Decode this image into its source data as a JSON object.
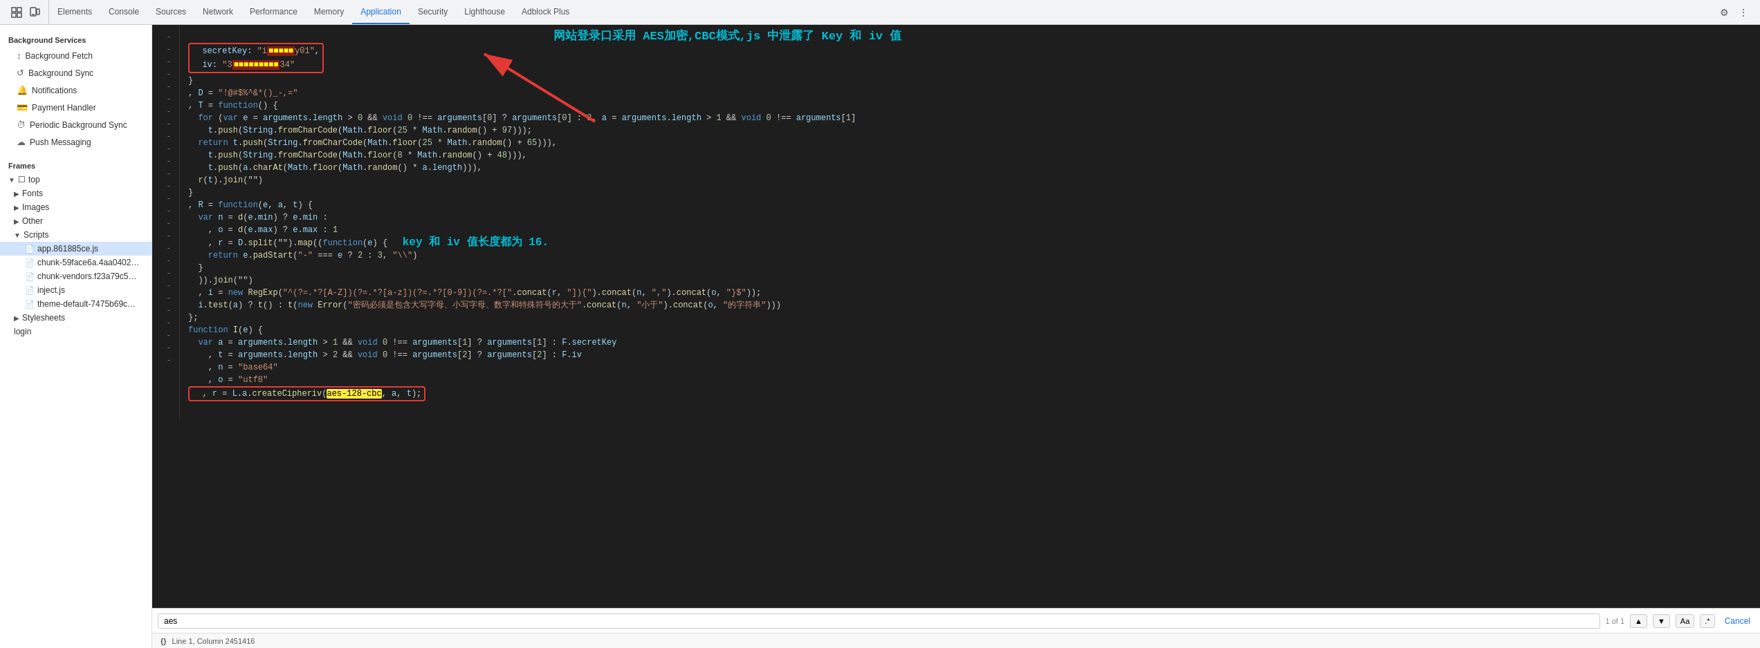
{
  "topNav": {
    "tabs": [
      {
        "label": "Elements",
        "active": false
      },
      {
        "label": "Console",
        "active": false
      },
      {
        "label": "Sources",
        "active": false
      },
      {
        "label": "Network",
        "active": false
      },
      {
        "label": "Performance",
        "active": false
      },
      {
        "label": "Memory",
        "active": false
      },
      {
        "label": "Application",
        "active": true
      },
      {
        "label": "Security",
        "active": false
      },
      {
        "label": "Lighthouse",
        "active": false
      },
      {
        "label": "Adblock Plus",
        "active": false
      }
    ]
  },
  "sidebar": {
    "backgroundServicesTitle": "Background Services",
    "backgroundServices": [
      {
        "label": "Background Fetch",
        "icon": "↕"
      },
      {
        "label": "Background Sync",
        "icon": "↺"
      },
      {
        "label": "Notifications",
        "icon": "🔔"
      },
      {
        "label": "Payment Handler",
        "icon": "💳"
      },
      {
        "label": "Periodic Background Sync",
        "icon": "⏱"
      },
      {
        "label": "Push Messaging",
        "icon": "☁"
      }
    ],
    "framesTitle": "Frames",
    "frames": [
      {
        "label": "top",
        "children": [
          {
            "label": "Fonts"
          },
          {
            "label": "Images"
          },
          {
            "label": "Other"
          },
          {
            "label": "Scripts",
            "expanded": true,
            "children": [
              {
                "label": "app.861885ce.js",
                "selected": true
              },
              {
                "label": "chunk-59face6a.4aa0402…"
              },
              {
                "label": "chunk-vendors.f23a79c5…"
              },
              {
                "label": "inject.js"
              },
              {
                "label": "theme-default-7475b69c…"
              }
            ]
          },
          {
            "label": "Stylesheets"
          },
          {
            "label": "login"
          }
        ]
      }
    ]
  },
  "code": {
    "lines": [
      {
        "num": "-",
        "content": "  secretKey: \"i■■■■■■■y01\","
      },
      {
        "num": "-",
        "content": "  iv: \"3■■■■■■■■■34\""
      },
      {
        "num": "-",
        "content": "}"
      },
      {
        "num": "-",
        "content": ", D = \"!@#$%^&*()_-,=\""
      },
      {
        "num": "-",
        "content": ", T = function() {"
      },
      {
        "num": "-",
        "content": "  for (var e = arguments.length > 0 && void 0 !== arguments[0] ? arguments[0] : 8, a = arguments.length > 1 && void 0 !== arguments[1]"
      },
      {
        "num": "-",
        "content": "    t.push(String.fromCharCode(Math.floor(25 * Math.random() + 97)));"
      },
      {
        "num": "-",
        "content": "  return t.push(String.fromCharCode(Math.floor(25 * Math.random() + 65))),"
      },
      {
        "num": "-",
        "content": "    t.push(String.fromCharCode(Math.floor(8 * Math.random() + 48))),"
      },
      {
        "num": "-",
        "content": "    t.push(a.charAt(Math.floor(Math.random() * a.length))),"
      },
      {
        "num": "-",
        "content": "  r(t).join(\"\")"
      },
      {
        "num": "-",
        "content": "}"
      },
      {
        "num": "-",
        "content": ", R = function(e, a, t) {"
      },
      {
        "num": "-",
        "content": "  var n = d(e.min) ? e.min :"
      },
      {
        "num": "-",
        "content": "    , o = d(e.max) ? e.max : 1"
      },
      {
        "num": "-",
        "content": "    , r = D.split(\"\").map((function(e) {"
      },
      {
        "num": "-",
        "content": "    return e.padStart(\"-\" === e ? 2 : 3, \"\\\\\")"
      },
      {
        "num": "-",
        "content": "  }"
      },
      {
        "num": "-",
        "content": "  )).join(\"\")"
      },
      {
        "num": "-",
        "content": "  , i = new RegExp(\"^(?=.*?[A-Z])(?=.*?[a-z])(?=.*?[0-9])(?=.*?[\\\".concat(r, \"]).{\").concat(n, \",\").concat(o, \"}$\"));"
      },
      {
        "num": "-",
        "content": "  i.test(a) ? t() : t(new Error(\"密码必须是包含大写字母、小写字母、数字和特殊符号的大于\".concat(n, \"小于\").concat(o, \"的字符串\")))"
      },
      {
        "num": "-",
        "content": "};"
      },
      {
        "num": "-",
        "content": "function I(e) {"
      },
      {
        "num": "-",
        "content": "  var a = arguments.length > 1 && void 0 !== arguments[1] ? arguments[1] : F.secretKey"
      },
      {
        "num": "-",
        "content": "    , t = arguments.length > 2 && void 0 !== arguments[2] ? arguments[2] : F.iv"
      },
      {
        "num": "-",
        "content": "    , n = \"base64\""
      },
      {
        "num": "-",
        "content": "    , o = \"utf8\""
      },
      {
        "num": "-",
        "content": "  , r = L.a.createCipheriv(\"aes-128-cbc\", a, t);"
      }
    ]
  },
  "annotations": {
    "chinese1": "网站登录口采用 AES加密,CBC模式,js 中泄露了 Key 和 iv 值",
    "chinese2": "key 和 iv 值长度都为 16."
  },
  "searchBar": {
    "inputValue": "aes",
    "results": "1 of 1",
    "matchCaseLabel": "Aa",
    "regexLabel": ".*",
    "cancelLabel": "Cancel"
  },
  "statusBar": {
    "braceIcon": "{}",
    "position": "Line 1, Column 2451416"
  }
}
